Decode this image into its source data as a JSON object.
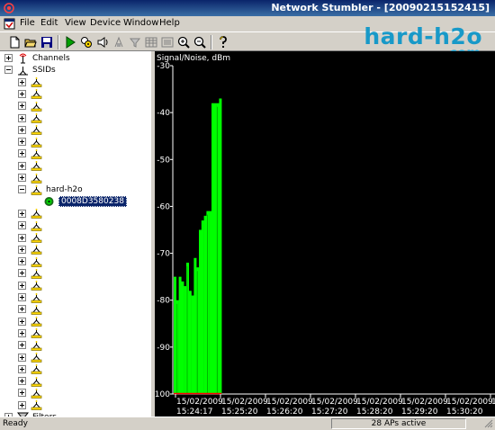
{
  "window": {
    "title": "Network Stumbler - [20090215152415]"
  },
  "menu": {
    "items": [
      "File",
      "Edit",
      "View",
      "Device",
      "Window",
      "Help"
    ]
  },
  "toolbar": {
    "buttons": [
      "new-file-icon",
      "open-folder-icon",
      "save-icon",
      "play-icon",
      "auto-config-icon",
      "speaker-icon",
      "sort-ap-icon",
      "filter-icon",
      "grid-icon",
      "list-icon",
      "zoom-in-icon",
      "zoom-out-icon",
      "help-icon"
    ]
  },
  "watermark": {
    "brand": "hard-h2o",
    "tld": ".com",
    "color": "#1899c8"
  },
  "tree": {
    "channels_label": "Channels",
    "ssids_label": "SSIDs",
    "expanded_ssid": "hard-h2o",
    "selected_ap": "0008D3580238",
    "filters_label": "Filters",
    "unnamed_ssids_before": 9,
    "unnamed_ssids_after": 17
  },
  "chart_data": {
    "type": "bar",
    "ylabel": "Signal/Noise, dBm",
    "ylim": [
      -100,
      -30
    ],
    "yticks": [
      -30,
      -40,
      -50,
      -60,
      -70,
      -80,
      -90,
      -100
    ],
    "xtick_labels": [
      [
        "15/02/2009",
        "15:24:17"
      ],
      [
        "15/02/2009",
        "15:25:20"
      ],
      [
        "15/02/2009",
        "15:26:20"
      ],
      [
        "15/02/2009",
        "15:27:20"
      ],
      [
        "15/02/2009",
        "15:28:20"
      ],
      [
        "15/02/2009",
        "15:29:20"
      ],
      [
        "15/02/2009",
        "15:30:20"
      ],
      [
        "15/02/2009",
        ""
      ]
    ],
    "series": [
      {
        "color": "#00ff00",
        "values": [
          -75,
          -80,
          -75,
          -76,
          -77,
          -72,
          -78,
          -79,
          -71,
          -73,
          -65,
          -63,
          -62,
          -61,
          -61,
          -38,
          -38,
          -38,
          -37
        ]
      }
    ],
    "grid": false
  },
  "status": {
    "left": "Ready",
    "aps": "28 APs active"
  }
}
